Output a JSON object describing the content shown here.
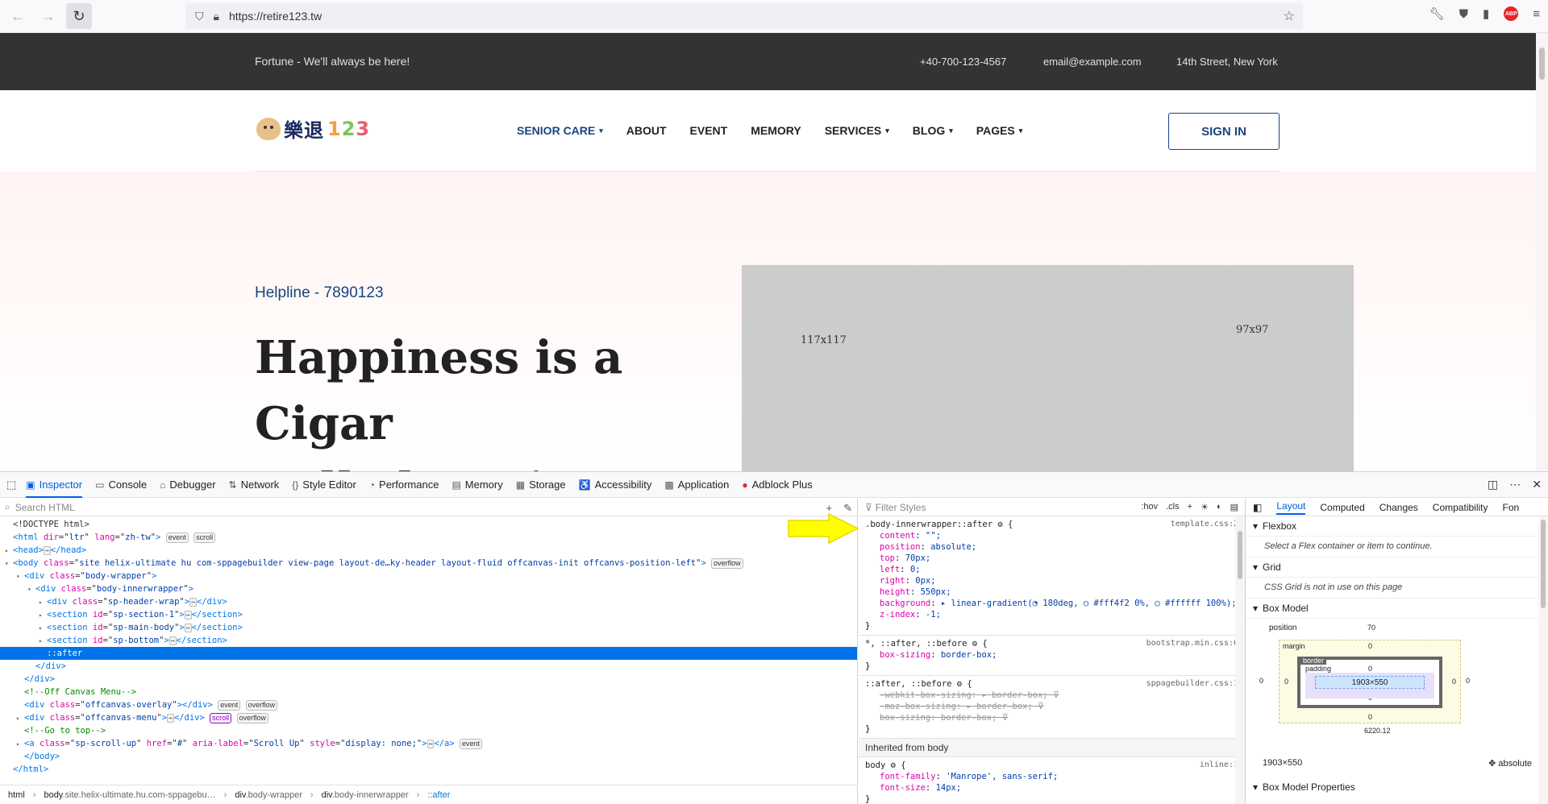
{
  "browser": {
    "back_icon": "arrow-left-icon",
    "forward_icon": "arrow-right-icon",
    "reload_icon": "reload-icon",
    "url": "https://retire123.tw",
    "abp_label": "ABP"
  },
  "site": {
    "tagline": "Fortune - We'll always be here!",
    "phone": "+40-700-123-4567",
    "email": "email@example.com",
    "address": "14th Street, New York",
    "logo_text": "樂退",
    "logo_digits": [
      "1",
      "2",
      "3"
    ],
    "nav": [
      {
        "label": "SENIOR CARE",
        "caret": "▾",
        "active": true
      },
      {
        "label": "ABOUT",
        "caret": ""
      },
      {
        "label": "EVENT",
        "caret": ""
      },
      {
        "label": "MEMORY",
        "caret": ""
      },
      {
        "label": "SERVICES",
        "caret": "▾"
      },
      {
        "label": "BLOG",
        "caret": "▾"
      },
      {
        "label": "PAGES",
        "caret": "▾"
      }
    ],
    "signin": "SIGN IN",
    "helpline": "Helpline - 7890123",
    "hero_line1": "Happiness is a Cigar",
    "hero_line2_plain": "Called ",
    "hero_line2_em": "Senior Care",
    "placeholder_a": "117x117",
    "placeholder_b": "97x97"
  },
  "devtools": {
    "tabs": [
      {
        "label": "Inspector",
        "icon": "inspector-icon",
        "glyph": "▣",
        "active": true
      },
      {
        "label": "Console",
        "icon": "console-icon",
        "glyph": "▭"
      },
      {
        "label": "Debugger",
        "icon": "debugger-icon",
        "glyph": "⌂"
      },
      {
        "label": "Network",
        "icon": "network-icon",
        "glyph": "⇅"
      },
      {
        "label": "Style Editor",
        "icon": "style-editor-icon",
        "glyph": "{}"
      },
      {
        "label": "Performance",
        "icon": "performance-icon",
        "glyph": "◔"
      },
      {
        "label": "Memory",
        "icon": "memory-icon",
        "glyph": "▤"
      },
      {
        "label": "Storage",
        "icon": "storage-icon",
        "glyph": "▦"
      },
      {
        "label": "Accessibility",
        "icon": "accessibility-icon",
        "glyph": "♿"
      },
      {
        "label": "Application",
        "icon": "application-icon",
        "glyph": "▩"
      },
      {
        "label": "Adblock Plus",
        "icon": "adblock-icon",
        "glyph": "●"
      }
    ],
    "search_placeholder": "Search HTML",
    "filter_placeholder": "Filter Styles",
    "hov": ":hov",
    "cls": ".cls",
    "tree": [
      {
        "indent": 0,
        "tw": "",
        "html": "<!DOCTYPE html>",
        "kind": "doctype"
      },
      {
        "indent": 0,
        "tw": "",
        "tag": "html",
        "attrs": [
          [
            "dir",
            "ltr"
          ],
          [
            "lang",
            "zh-tw"
          ]
        ],
        "close": "",
        "badges": [
          "event",
          "scroll"
        ]
      },
      {
        "indent": 0,
        "tw": "▸",
        "tag": "head",
        "attrs": [],
        "close": "</head>",
        "ellip": true
      },
      {
        "indent": 0,
        "tw": "▾",
        "tag": "body",
        "attrs": [
          [
            "class",
            "site helix-ultimate hu com-sppagebuilder view-page layout-de…ky-header layout-fluid offcanvas-init offcanvs-position-left"
          ]
        ],
        "close": "",
        "badges": [
          "overflow"
        ]
      },
      {
        "indent": 1,
        "tw": "▾",
        "tag": "div",
        "attrs": [
          [
            "class",
            "body-wrapper"
          ]
        ],
        "close": ""
      },
      {
        "indent": 2,
        "tw": "▾",
        "tag": "div",
        "attrs": [
          [
            "class",
            "body-innerwrapper"
          ]
        ],
        "close": ""
      },
      {
        "indent": 3,
        "tw": "▸",
        "tag": "div",
        "attrs": [
          [
            "class",
            "sp-header-wrap"
          ]
        ],
        "close": "</div>",
        "ellip": true
      },
      {
        "indent": 3,
        "tw": "▸",
        "tag": "section",
        "attrs": [
          [
            "id",
            "sp-section-1"
          ]
        ],
        "close": "</section>",
        "ellip": true
      },
      {
        "indent": 3,
        "tw": "▸",
        "tag": "section",
        "attrs": [
          [
            "id",
            "sp-main-body"
          ]
        ],
        "close": "</section>",
        "ellip": true
      },
      {
        "indent": 3,
        "tw": "▸",
        "tag": "section",
        "attrs": [
          [
            "id",
            "sp-bottom"
          ]
        ],
        "close": "</section>",
        "ellip": true
      },
      {
        "indent": 3,
        "tw": "",
        "html": "::after",
        "kind": "pseudo",
        "selected": true
      },
      {
        "indent": 2,
        "tw": "",
        "html": "</div>",
        "kind": "closetag"
      },
      {
        "indent": 1,
        "tw": "",
        "html": "</div>",
        "kind": "closetag"
      },
      {
        "indent": 1,
        "tw": "",
        "html": "<!--Off Canvas Menu-->",
        "kind": "comment"
      },
      {
        "indent": 1,
        "tw": "",
        "tag": "div",
        "attrs": [
          [
            "class",
            "offcanvas-overlay"
          ]
        ],
        "close": "</div>",
        "badges": [
          "event",
          "overflow"
        ]
      },
      {
        "indent": 1,
        "tw": "▸",
        "tag": "div",
        "attrs": [
          [
            "class",
            "offcanvas-menu"
          ]
        ],
        "close": "</div>",
        "ellip": true,
        "badges": [
          "scroll*",
          "overflow"
        ]
      },
      {
        "indent": 1,
        "tw": "",
        "html": "<!--Go to top-->",
        "kind": "comment"
      },
      {
        "indent": 1,
        "tw": "▸",
        "tag": "a",
        "attrs": [
          [
            "class",
            "sp-scroll-up"
          ],
          [
            "href",
            "#"
          ],
          [
            "aria-label",
            "Scroll Up"
          ],
          [
            "style",
            "display: none;"
          ]
        ],
        "close": "</a>",
        "ellip": true,
        "badges": [
          "event"
        ]
      },
      {
        "indent": 1,
        "tw": "",
        "html": "</body>",
        "kind": "closetag"
      },
      {
        "indent": 0,
        "tw": "",
        "html": "</html>",
        "kind": "closetag"
      }
    ],
    "breadcrumbs": [
      {
        "main": "html",
        "muted": ""
      },
      {
        "main": "body",
        "muted": ".site.helix-ultimate.hu.com-sppagebu…"
      },
      {
        "main": "div",
        "muted": ".body-wrapper"
      },
      {
        "main": "div",
        "muted": ".body-innerwrapper"
      },
      {
        "main": "::after",
        "muted": "",
        "current": true
      }
    ],
    "rules": [
      {
        "selector": ".body-innerwrapper::after ⚙ {",
        "src": "template.css:2",
        "decls": [
          [
            "content",
            "\"\";"
          ],
          [
            "position",
            "absolute;"
          ],
          [
            "top",
            "70px;"
          ],
          [
            "left",
            "0;"
          ],
          [
            "right",
            "0px;"
          ],
          [
            "height",
            "550px;"
          ],
          [
            "background",
            "▸ linear-gradient(◔ 180deg, ○ #fff4f2 0%, ○ #ffffff 100%);"
          ],
          [
            "z-index",
            "-1;"
          ]
        ]
      },
      {
        "selector": "*, ::after, ::before ⚙ {",
        "src": "bootstrap.min.css:6",
        "decls": [
          [
            "box-sizing",
            "border-box;"
          ]
        ]
      },
      {
        "selector": "::after, ::before ⚙ {",
        "src": "sppagebuilder.css:1",
        "strike": true,
        "decls": [
          [
            "-webkit-box-sizing",
            "▸ border-box;"
          ],
          [
            "-moz-box-sizing",
            "▸ border-box;"
          ],
          [
            "box-sizing",
            "border-box;"
          ]
        ]
      }
    ],
    "inherited_label": "Inherited from body",
    "body_rule": {
      "selector": "body ⚙ {",
      "src": "inline:1",
      "decls": [
        [
          "font-family",
          "'Manrope', sans-serif;"
        ],
        [
          "font-size",
          "14px;"
        ]
      ]
    },
    "layout_tabs": [
      "Layout",
      "Computed",
      "Changes",
      "Compatibility",
      "Fon"
    ],
    "flexbox_title": "Flexbox",
    "flexbox_msg": "Select a Flex container or item to continue.",
    "grid_title": "Grid",
    "grid_msg": "CSS Grid is not in use on this page",
    "boxmodel_title": "Box Model",
    "bm": {
      "position_label": "position",
      "position_top": "70",
      "position_left": "0",
      "position_right": "0",
      "position_bottom": "6220.12",
      "margin_label": "margin",
      "border_label": "border",
      "padding_label": "padding",
      "content": "1903×550",
      "zero": "0"
    },
    "size_readout": "1903×550",
    "position_readout": "absolute",
    "box_props": "Box Model Properties"
  }
}
